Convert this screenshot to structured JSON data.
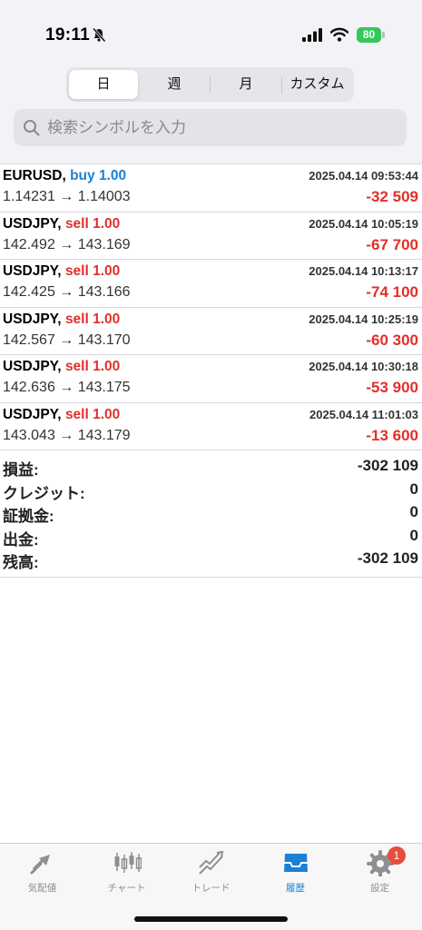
{
  "status": {
    "time": "19:11",
    "battery": "80"
  },
  "period_tabs": [
    {
      "label": "日",
      "active": true
    },
    {
      "label": "週",
      "active": false
    },
    {
      "label": "月",
      "active": false
    },
    {
      "label": "カスタム",
      "active": false
    }
  ],
  "search": {
    "placeholder": "検索シンボルを入力"
  },
  "deals": [
    {
      "symbol": "EURUSD,",
      "side": "buy 1.00",
      "type": "buy",
      "datetime": "2025.04.14 09:53:44",
      "prices": "1.14231 → 1.14003",
      "profit": "-32 509"
    },
    {
      "symbol": "USDJPY,",
      "side": "sell 1.00",
      "type": "sell",
      "datetime": "2025.04.14 10:05:19",
      "prices": "142.492 → 143.169",
      "profit": "-67 700"
    },
    {
      "symbol": "USDJPY,",
      "side": "sell 1.00",
      "type": "sell",
      "datetime": "2025.04.14 10:13:17",
      "prices": "142.425 → 143.166",
      "profit": "-74 100"
    },
    {
      "symbol": "USDJPY,",
      "side": "sell 1.00",
      "type": "sell",
      "datetime": "2025.04.14 10:25:19",
      "prices": "142.567 → 143.170",
      "profit": "-60 300"
    },
    {
      "symbol": "USDJPY,",
      "side": "sell 1.00",
      "type": "sell",
      "datetime": "2025.04.14 10:30:18",
      "prices": "142.636 → 143.175",
      "profit": "-53 900"
    },
    {
      "symbol": "USDJPY,",
      "side": "sell 1.00",
      "type": "sell",
      "datetime": "2025.04.14 11:01:03",
      "prices": "143.043 → 143.179",
      "profit": "-13 600"
    }
  ],
  "summary": [
    {
      "label": "損益:",
      "value": "-302 109"
    },
    {
      "label": "クレジット:",
      "value": "0"
    },
    {
      "label": "証拠金:",
      "value": "0"
    },
    {
      "label": "出金:",
      "value": "0"
    },
    {
      "label": "残高:",
      "value": "-302 109"
    }
  ],
  "tabbar": [
    {
      "label": "気配値",
      "icon": "quotes-icon",
      "active": false
    },
    {
      "label": "チャート",
      "icon": "chart-icon",
      "active": false
    },
    {
      "label": "トレード",
      "icon": "trade-icon",
      "active": false
    },
    {
      "label": "履歴",
      "icon": "history-icon",
      "active": true
    },
    {
      "label": "設定",
      "icon": "settings-icon",
      "active": false,
      "badge": "1"
    }
  ],
  "colors": {
    "accent": "#1a80d8",
    "loss": "#e0302a",
    "battery": "#34c759"
  }
}
